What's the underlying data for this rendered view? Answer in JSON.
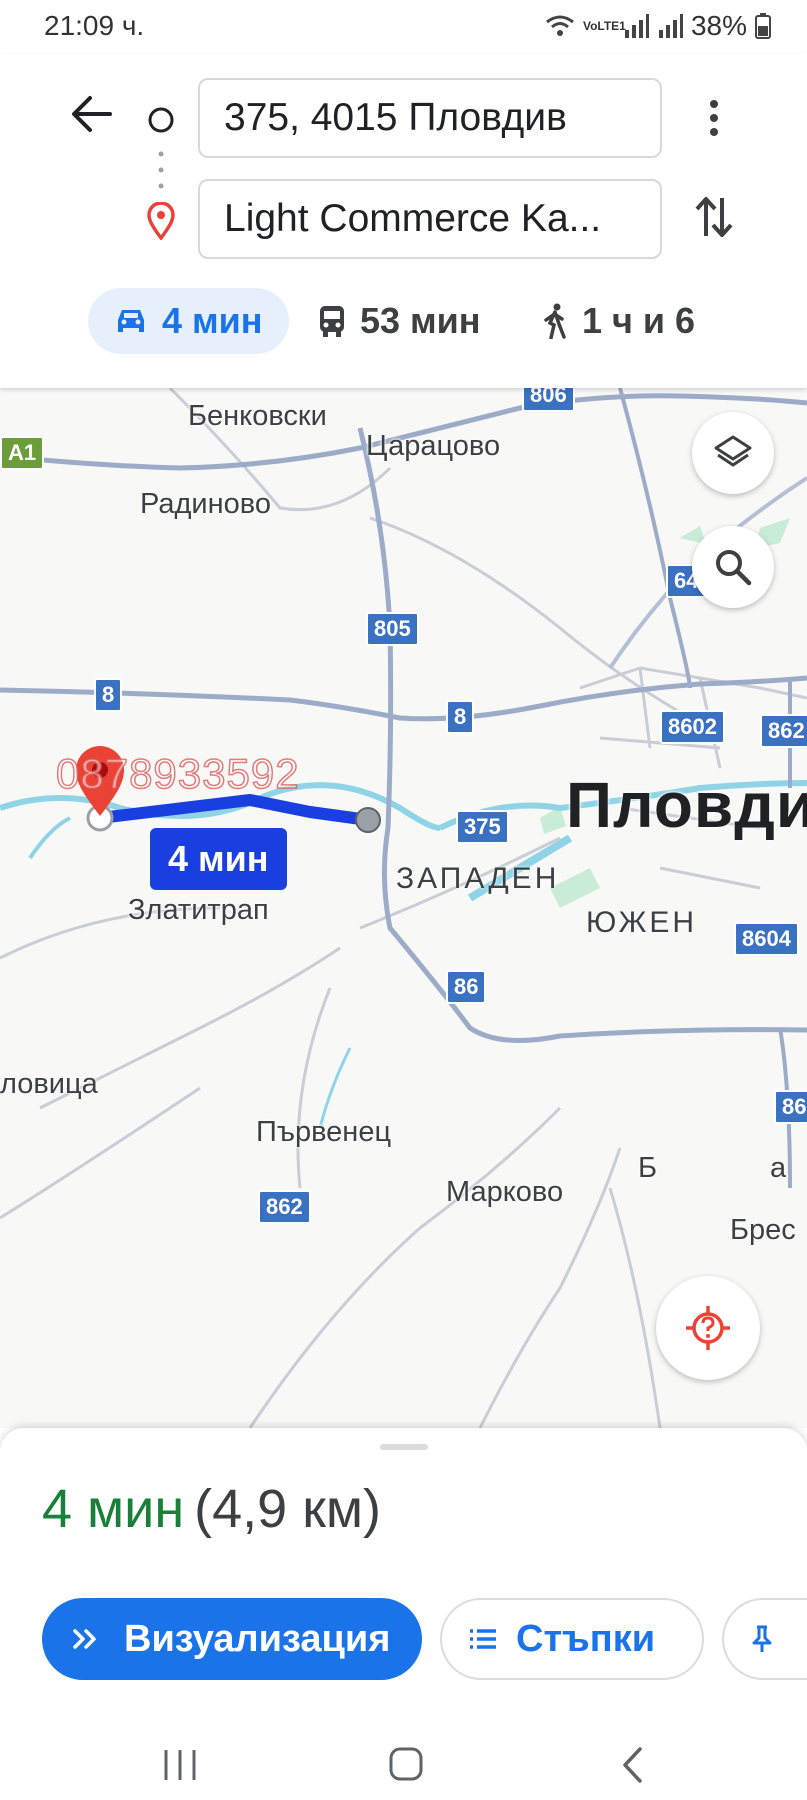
{
  "status_bar": {
    "time": "21:09 ч.",
    "network": "VoLTE1",
    "battery": "38%"
  },
  "route": {
    "origin": "375, 4015 Пловдив",
    "destination": "Light Commerce Ka..."
  },
  "modes": [
    {
      "icon": "car-icon",
      "label": "4 мин",
      "active": true
    },
    {
      "icon": "bus-icon",
      "label": "53 мин",
      "active": false
    },
    {
      "icon": "walk-icon",
      "label": "1 ч и 6",
      "active": false
    }
  ],
  "map": {
    "places": {
      "benkovski": "Бенковски",
      "caracovo": "Царацово",
      "radinovo": "Радиново",
      "zlatitrap": "Златитрап",
      "yagodovo": "ловица",
      "parvenets": "Първенец",
      "markovo": "Марково",
      "belashtitsa": "Б",
      "belashtitsa_end": "а",
      "brestnik": "Брес",
      "plovdiv": "Пловди",
      "zapaden": "ЗАПАДЕН",
      "yuzhen": "ЮЖЕН"
    },
    "road_shields": {
      "a1": "A1",
      "r8a": "8",
      "r8b": "8",
      "r64": "64",
      "r805": "805",
      "r8602": "8602",
      "r862a": "862",
      "r375": "375",
      "r8604": "8604",
      "r86a": "86",
      "r86b": "86",
      "r862b": "862",
      "top": "806"
    },
    "route_badge": "4 мин",
    "watermark": "0878933592"
  },
  "summary": {
    "duration": "4 мин",
    "distance": "(4,9 км)",
    "duration_color": "#188038"
  },
  "actions": {
    "visualize": "Визуализация",
    "steps": "Стъпки"
  },
  "colors": {
    "accent": "#1a73e8",
    "route": "#1a3fe0",
    "pin": "#ea4335"
  }
}
